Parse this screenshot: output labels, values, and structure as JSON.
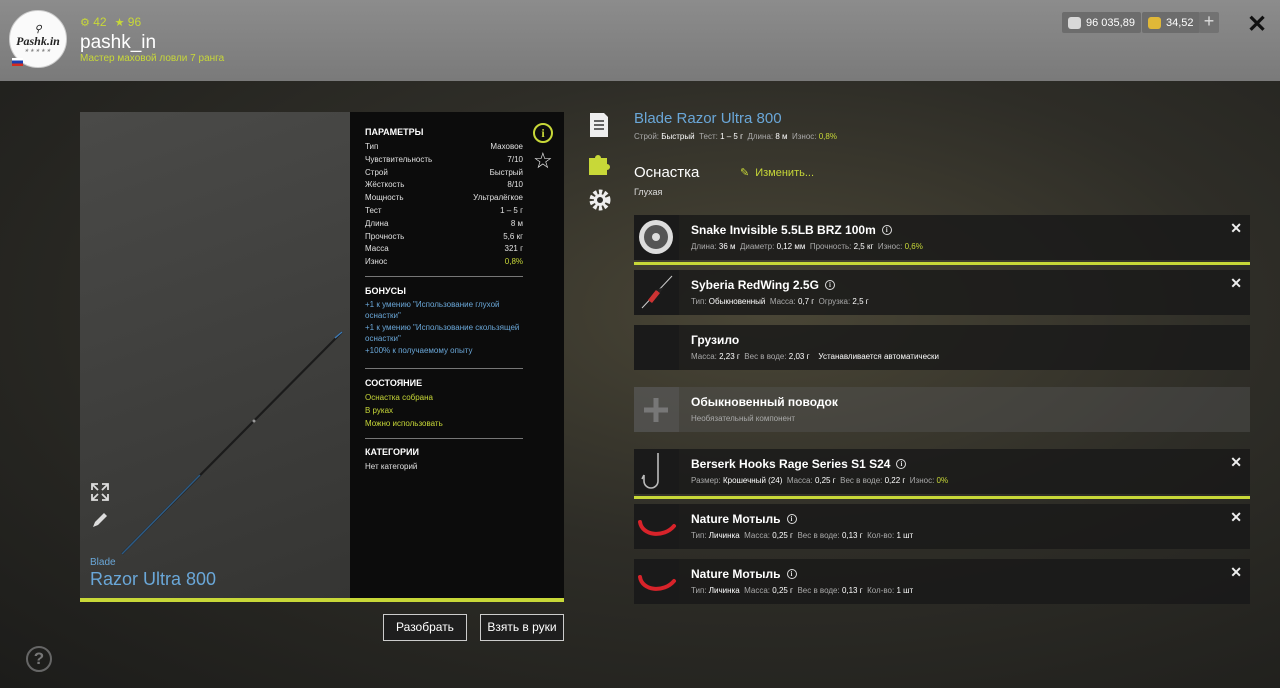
{
  "header": {
    "logo_text": "Pashk.in",
    "stat_a": "42",
    "stat_b": "96",
    "username": "pashk_in",
    "rank": "Мастер маховой ловли 7 ранга",
    "silver": "96 035,89",
    "gold": "34,52",
    "plus": "+",
    "close": "✕"
  },
  "rod": {
    "brand": "Blade",
    "model": "Razor Ultra 800"
  },
  "params": {
    "title": "ПАРАМЕТРЫ",
    "rows": [
      {
        "label": "Тип",
        "value": "Маховое"
      },
      {
        "label": "Чувствительность",
        "value": "7/10"
      },
      {
        "label": "Строй",
        "value": "Быстрый"
      },
      {
        "label": "Жёсткость",
        "value": "8/10"
      },
      {
        "label": "Мощность",
        "value": "Ультралёгкое"
      },
      {
        "label": "Тест",
        "value": "1 – 5 г"
      },
      {
        "label": "Длина",
        "value": "8 м"
      },
      {
        "label": "Прочность",
        "value": "5,6 кг"
      },
      {
        "label": "Масса",
        "value": "321 г"
      },
      {
        "label": "Износ",
        "value": "0,8%"
      }
    ],
    "bonus_title": "БОНУСЫ",
    "bonuses": [
      "+1 к умению \"Использование глухой оснастки\"",
      "+1 к умению \"Использование скользящей оснастки\"",
      "+100% к получаемому опыту"
    ],
    "state_title": "СОСТОЯНИЕ",
    "states": [
      "Оснастка собрана",
      "В руках",
      "Можно использовать"
    ],
    "cat_title": "КАТЕГОРИИ",
    "cat_value": "Нет категорий"
  },
  "buttons": {
    "disassemble": "Разобрать",
    "take": "Взять в руки"
  },
  "right": {
    "title": "Blade Razor Ultra 800",
    "sub": {
      "k1": "Строй:",
      "v1": "Быстрый",
      "k2": "Тест:",
      "v2": "1 – 5 г",
      "k3": "Длина:",
      "v3": "8 м",
      "k4": "Износ:",
      "v4": "0,8%"
    },
    "rig_label": "Оснастка",
    "rig_type": "Глухая",
    "change": "Изменить..."
  },
  "items": [
    {
      "name": "Snake Invisible 5.5LB BRZ 100m",
      "d": [
        [
          "Длина:",
          "36 м"
        ],
        [
          "Диаметр:",
          "0,12 мм"
        ],
        [
          "Прочность:",
          "2,5 кг"
        ],
        [
          "Износ:",
          "0,6%"
        ]
      ]
    },
    {
      "name": "Syberia RedWing 2.5G",
      "d": [
        [
          "Тип:",
          "Обыкновенный"
        ],
        [
          "Масса:",
          "0,7 г"
        ],
        [
          "Огрузка:",
          "2,5 г"
        ]
      ]
    },
    {
      "name": "Грузило",
      "d": [
        [
          "Масса:",
          "2,23 г"
        ],
        [
          "Вес в воде:",
          "2,03 г"
        ]
      ],
      "note": "Устанавливается автоматически"
    },
    {
      "name": "Обыкновенный поводок",
      "note": "Необязательный компонент"
    },
    {
      "name": "Berserk Hooks Rage Series S1 S24",
      "d": [
        [
          "Размер:",
          "Крошечный (24)"
        ],
        [
          "Масса:",
          "0,25 г"
        ],
        [
          "Вес в воде:",
          "0,22 г"
        ],
        [
          "Износ:",
          "0%"
        ]
      ]
    },
    {
      "name": "Nature Мотыль",
      "d": [
        [
          "Тип:",
          "Личинка"
        ],
        [
          "Масса:",
          "0,25 г"
        ],
        [
          "Вес в воде:",
          "0,13 г"
        ],
        [
          "Кол-во:",
          "1 шт"
        ]
      ]
    },
    {
      "name": "Nature Мотыль",
      "d": [
        [
          "Тип:",
          "Личинка"
        ],
        [
          "Масса:",
          "0,25 г"
        ],
        [
          "Вес в воде:",
          "0,13 г"
        ],
        [
          "Кол-во:",
          "1 шт"
        ]
      ]
    }
  ],
  "help": "?",
  "colors": {
    "accent": "#c8d838",
    "blue": "#6aa7d8"
  }
}
